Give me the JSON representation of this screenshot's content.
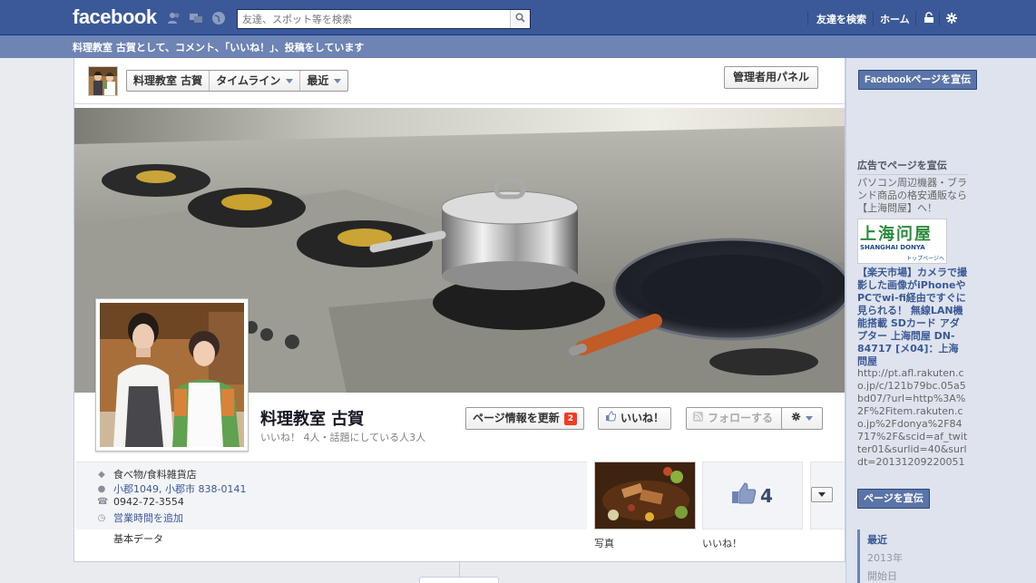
{
  "header": {
    "logo": "facebook",
    "search_placeholder": "友達、スポット等を検索",
    "find_friends": "友達を検索",
    "home": "ホーム"
  },
  "acting_bar": {
    "text": "料理教室 古賀として、コメント、「いいね！」、投稿をしています"
  },
  "subnav": {
    "page_name": "料理教室 古賀",
    "timeline": "タイムライン",
    "recent": "最近",
    "admin_panel": "管理者用パネル"
  },
  "profile": {
    "name": "料理教室 古賀",
    "stats": "いいね！ 4人・話題にしている人3人",
    "update_info": "ページ情報を更新",
    "update_badge": "2",
    "like": "いいね！",
    "follow": "フォローする"
  },
  "about": {
    "category": "食べ物/食料雑貨店",
    "address": "小郡1049, 小郡市 838-0141",
    "phone": "0942-72-3554",
    "hours": "営業時間を追加",
    "basic_data": "基本データ"
  },
  "apps": {
    "photos": "写真",
    "likes": "いいね！",
    "like_count": "4"
  },
  "sidebar": {
    "promote_page": "Facebookページを宣伝",
    "ad_section_title": "広告でページを宣伝",
    "ad_description": "パソコン周辺機器・ブランド商品の格安通販なら【上海問屋】へ！",
    "ad_logo_text": "上海问屋",
    "ad_logo_sub": "SHANGHAI DONYA",
    "ad_logo_link": "トップページへ",
    "ad_headline": "【楽天市場】カメラで撮影した画像がiPhoneやPCでwi-fi経由ですぐに見られる！ 無線LAN機能搭載 SDカード アダプター 上海問屋 DN-84717 [メ04]：上海問屋",
    "ad_url": "http://pt.afl.rakuten.co.jp/c/121b79bc.05a5bd07/?url=http%3A%2F%2Fitem.rakuten.co.jp%2Fdonya%2F84717%2F&scid=af_twitter01&surlid=40&surldt=20131209220051",
    "promote_button": "ページを宣伝",
    "years": [
      "最近",
      "2013年",
      "開始日"
    ]
  },
  "colors": {
    "brand_blue": "#3b5998",
    "acting_bar": "#6d84b4",
    "badge_red": "#f03d25"
  }
}
